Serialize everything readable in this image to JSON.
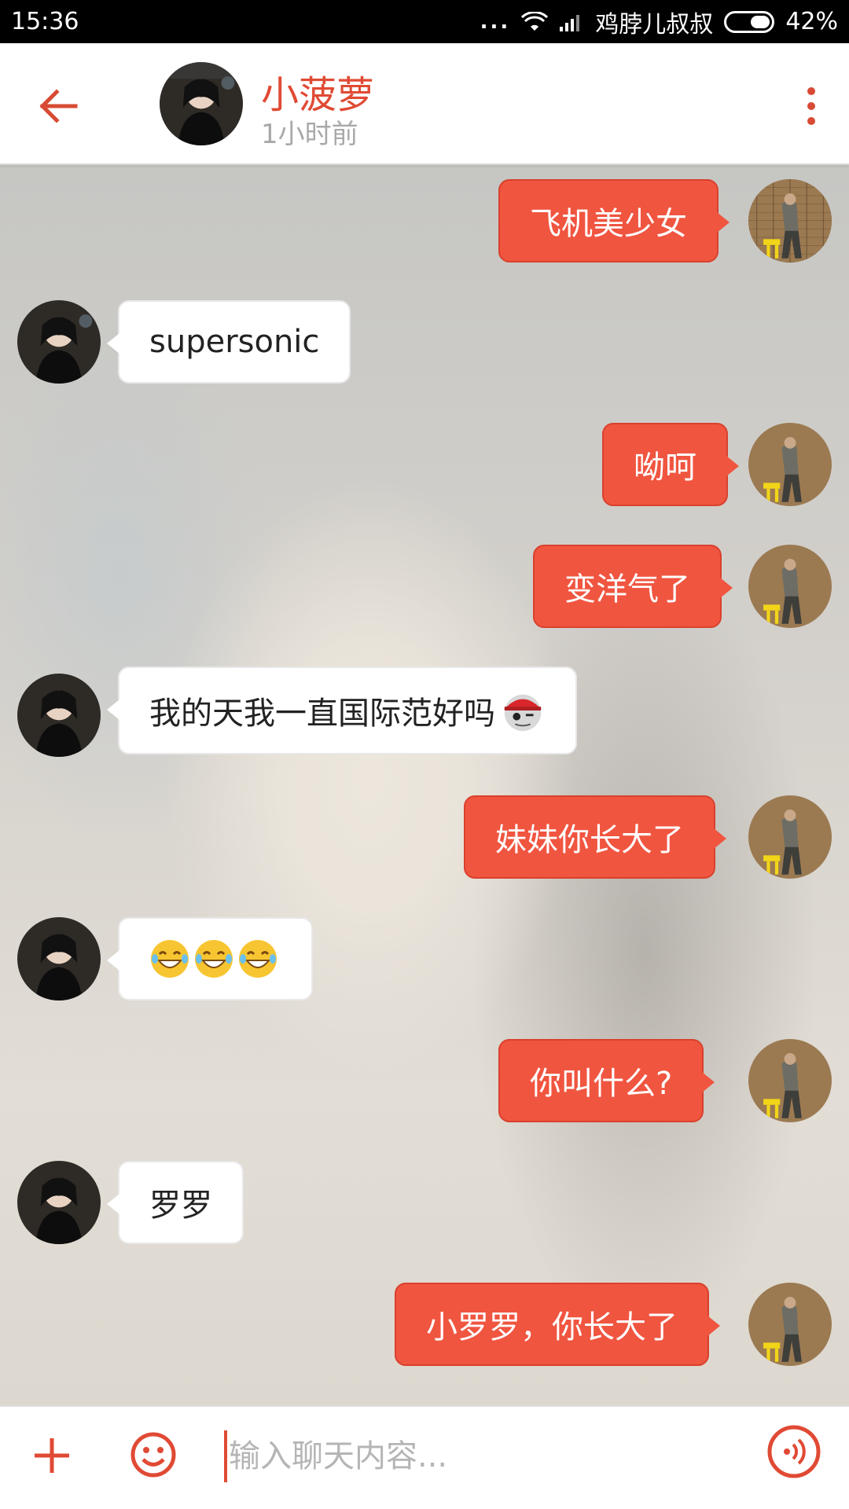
{
  "status_bar": {
    "time": "15:36",
    "dots": "...",
    "carrier": "鸡脖儿叔叔",
    "battery": "42%",
    "battery_level": 0.42,
    "icons": [
      "wifi-icon",
      "signal-icon",
      "battery-icon"
    ]
  },
  "header": {
    "title": "小菠萝",
    "subtitle": "1小时前",
    "icons": [
      "back-arrow-icon",
      "more-vert-icon"
    ]
  },
  "messages": [
    {
      "side": "out",
      "text": "飞机美少女"
    },
    {
      "side": "in",
      "text": "supersonic"
    },
    {
      "side": "out",
      "text": "呦呵"
    },
    {
      "side": "out",
      "text": "变洋气了"
    },
    {
      "side": "in",
      "text": "我的天我一直国际范好吗",
      "emoji": "pirate-face"
    },
    {
      "side": "out",
      "text": "妹妹你长大了"
    },
    {
      "side": "in",
      "text": "",
      "emoji": [
        "laughing-tears",
        "laughing-tears",
        "laughing-tears"
      ]
    },
    {
      "side": "out",
      "text": "你叫什么?"
    },
    {
      "side": "in",
      "text": "罗罗"
    },
    {
      "side": "out",
      "text": "小罗罗，你长大了"
    }
  ],
  "input_bar": {
    "placeholder": "输入聊天内容...",
    "icons": [
      "plus-icon",
      "emoji-icon",
      "voice-icon"
    ]
  },
  "colors": {
    "accent": "#e04a34",
    "outgoing_bubble": "#f05540",
    "incoming_bubble": "#ffffff"
  }
}
